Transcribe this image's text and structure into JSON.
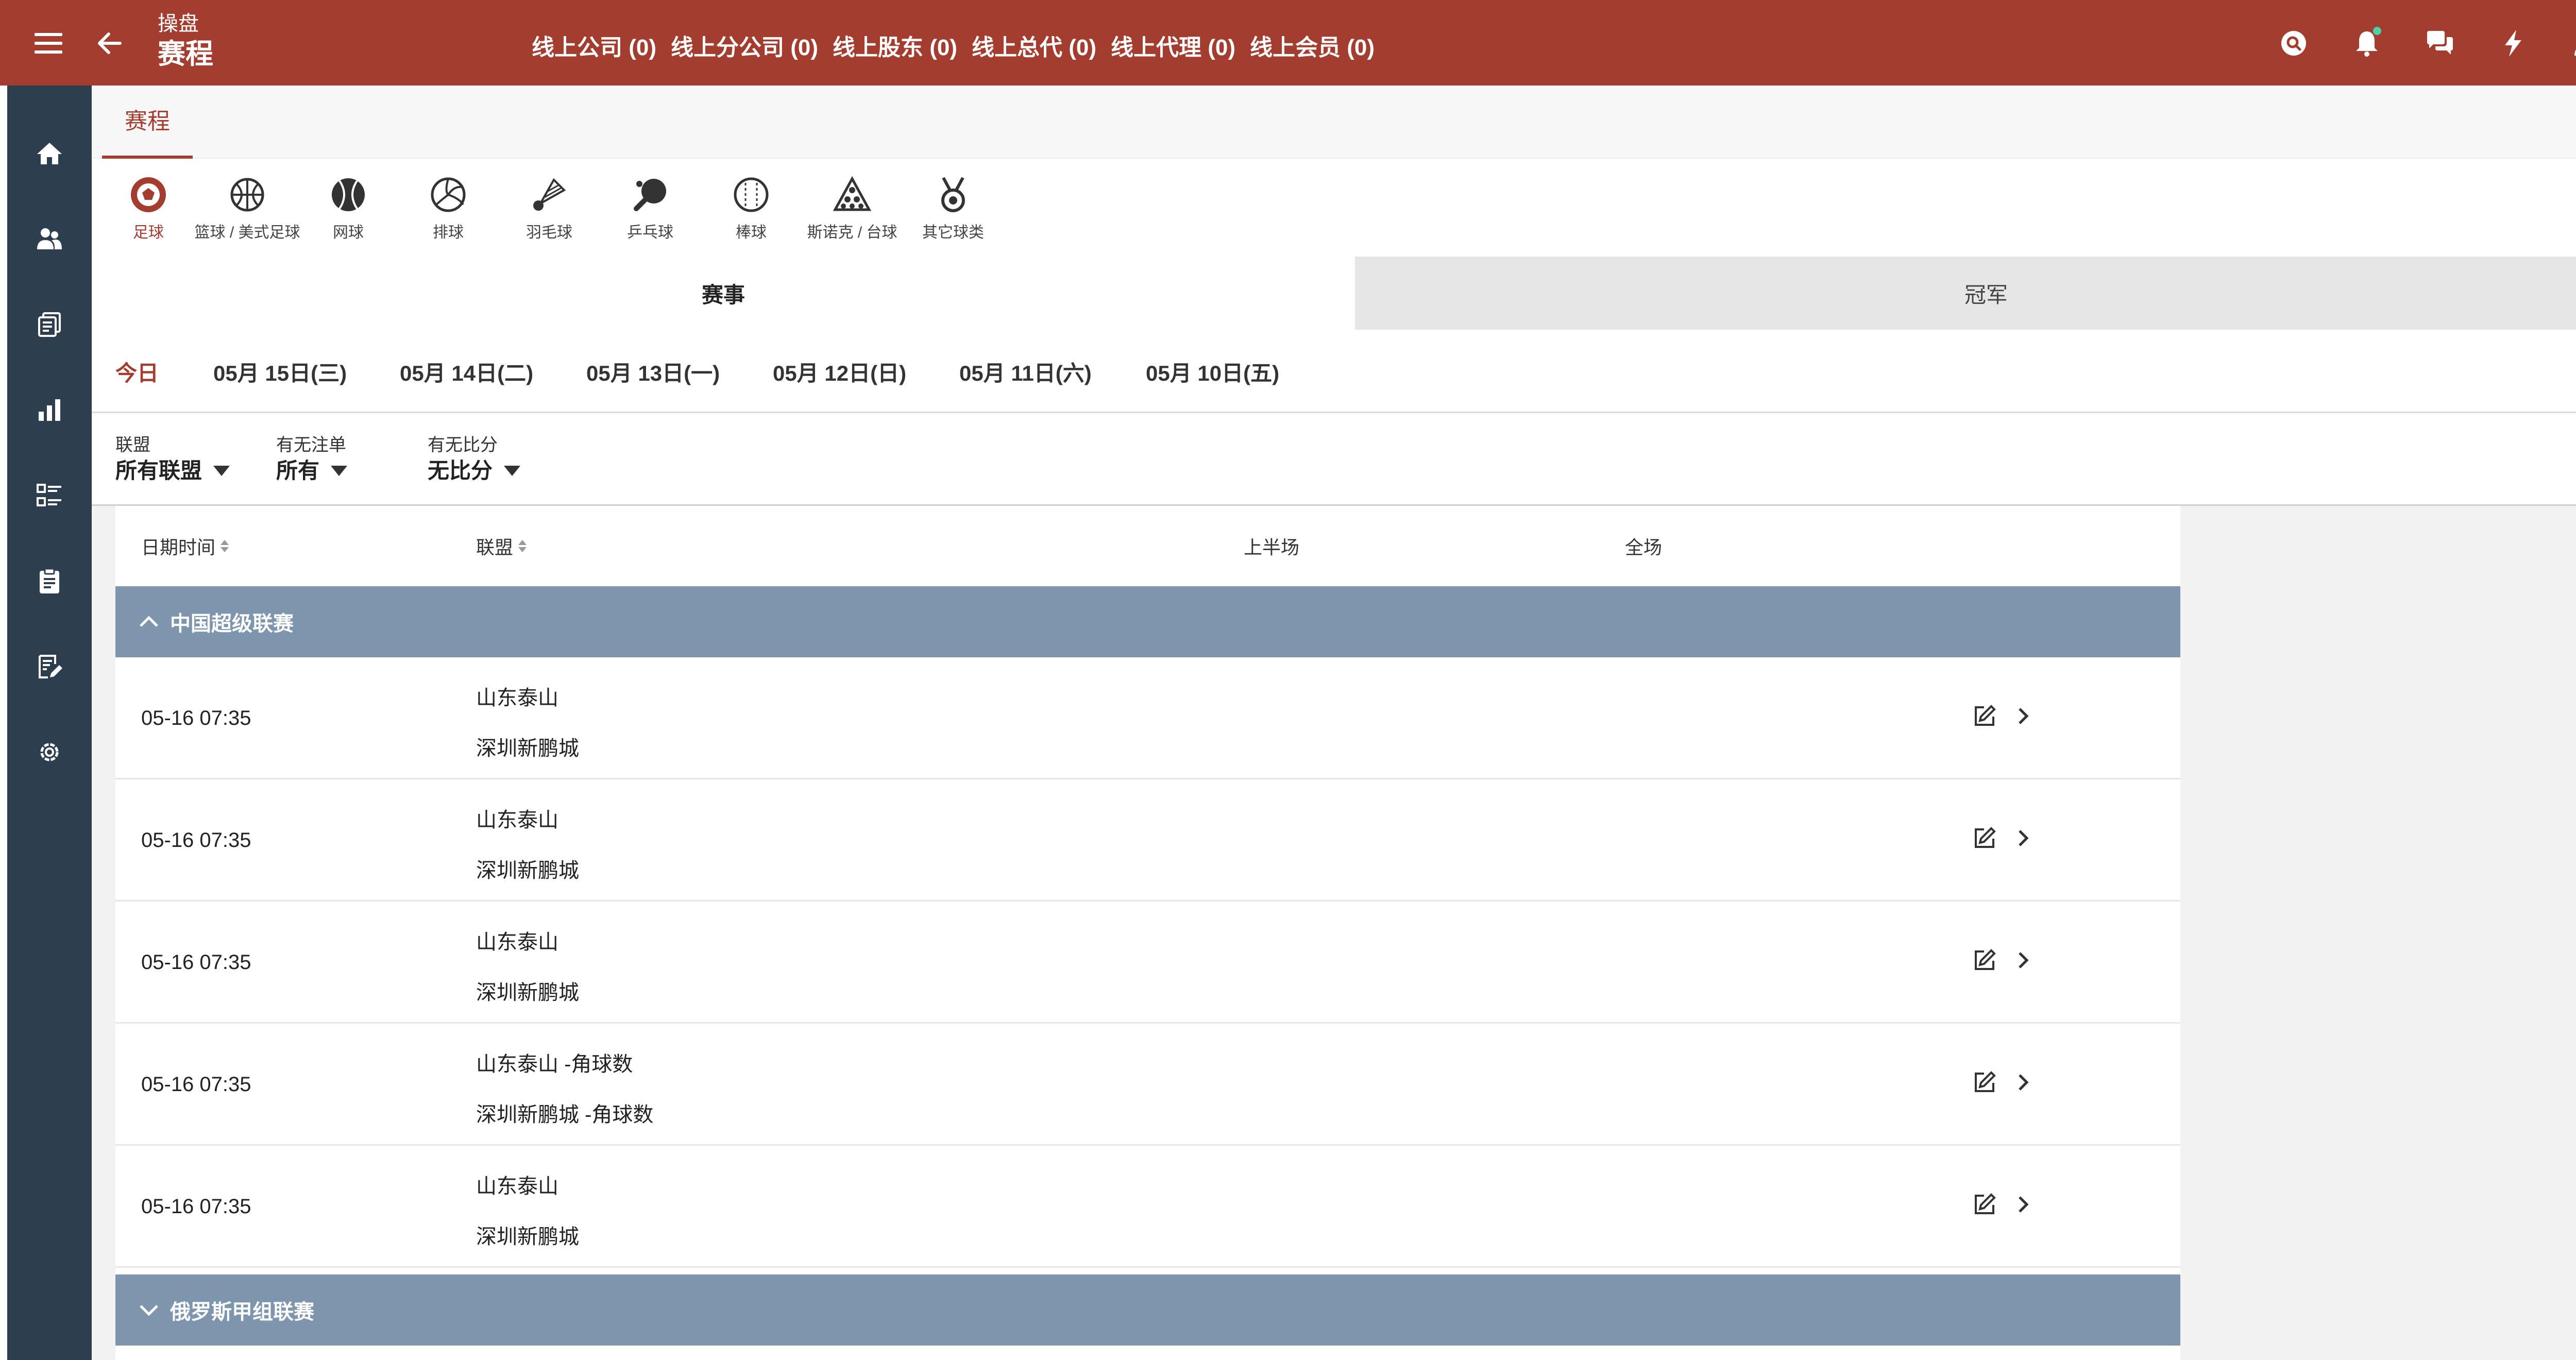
{
  "header": {
    "breadcrumb_parent": "操盘",
    "title": "赛程",
    "online_stats": [
      "线上公司 (0)",
      "线上分公司 (0)",
      "线上股东 (0)",
      "线上总代 (0)",
      "线上代理 (0)",
      "线上会员 (0)"
    ]
  },
  "page_tab": "赛程",
  "sports": [
    "足球",
    "篮球 / 美式足球",
    "网球",
    "排球",
    "羽毛球",
    "乒乓球",
    "棒球",
    "斯诺克 / 台球",
    "其它球类"
  ],
  "segments": {
    "events": "赛事",
    "champion": "冠军"
  },
  "dates": [
    "今日",
    "05月 15日(三)",
    "05月 14日(二)",
    "05月 13日(一)",
    "05月 12日(日)",
    "05月 11日(六)",
    "05月 10日(五)"
  ],
  "filters": {
    "league": {
      "label": "联盟",
      "value": "所有联盟"
    },
    "bets": {
      "label": "有无注单",
      "value": "所有"
    },
    "score": {
      "label": "有无比分",
      "value": "无比分"
    }
  },
  "table": {
    "headers": {
      "datetime": "日期时间",
      "league": "联盟",
      "first_half": "上半场",
      "full": "全场"
    },
    "groups": [
      {
        "league": "中国超级联赛",
        "matches": [
          {
            "time": "05-16 07:35",
            "home": "山东泰山",
            "away": "深圳新鹏城"
          },
          {
            "time": "05-16 07:35",
            "home": "山东泰山",
            "away": "深圳新鹏城"
          },
          {
            "time": "05-16 07:35",
            "home": "山东泰山",
            "away": "深圳新鹏城"
          },
          {
            "time": "05-16 07:35",
            "home": "山东泰山 -角球数",
            "away": "深圳新鹏城 -角球数"
          },
          {
            "time": "05-16 07:35",
            "home": "山东泰山",
            "away": "深圳新鹏城"
          }
        ]
      },
      {
        "league": "俄罗斯甲组联赛",
        "matches": []
      }
    ]
  },
  "colors": {
    "brand": "#a33d2f",
    "sidebar": "#2d3e4e",
    "league_bar": "#7d95ad",
    "notification_dot": "#4fd1a5"
  }
}
